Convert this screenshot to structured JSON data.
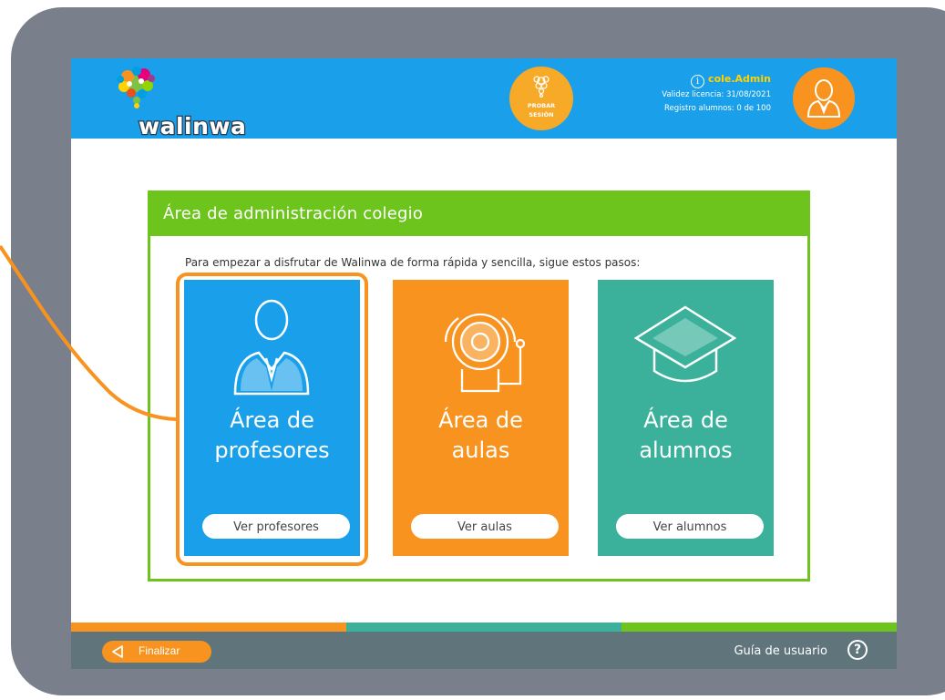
{
  "header": {
    "logo_text": "walinwa",
    "try_session": {
      "line1": "PROBAR",
      "line2": "SESIÓN"
    },
    "user": {
      "name": "cole.Admin",
      "license": "Validez licencia: 31/08/2021",
      "students": "Registro alumnos: 0 de 100"
    }
  },
  "admin_panel": {
    "title": "Área de administración colegio",
    "intro": "Para empezar a disfrutar de Walinwa de forma rápida y sencilla, sigue estos pasos:",
    "cards": [
      {
        "title_line1": "Área de",
        "title_line2": "profesores",
        "button": "Ver profesores",
        "icon": "teacher-icon",
        "color": "#1aa0ea"
      },
      {
        "title_line1": "Área de",
        "title_line2": "aulas",
        "button": "Ver aulas",
        "icon": "school-bell-icon",
        "color": "#f7931e"
      },
      {
        "title_line1": "Área de",
        "title_line2": "alumnos",
        "button": "Ver alumnos",
        "icon": "graduation-cap-icon",
        "color": "#3bb19b"
      }
    ]
  },
  "footer": {
    "finish": "Finalizar",
    "guide": "Guía de usuario",
    "help": "?",
    "stripe_colors": [
      "#f7931e",
      "#3bb19b",
      "#6cc41d"
    ]
  },
  "colors": {
    "frame": "#7a7f8c",
    "header": "#1aa0ea",
    "accent": "#f7931e",
    "panel": "#6cc41d"
  }
}
